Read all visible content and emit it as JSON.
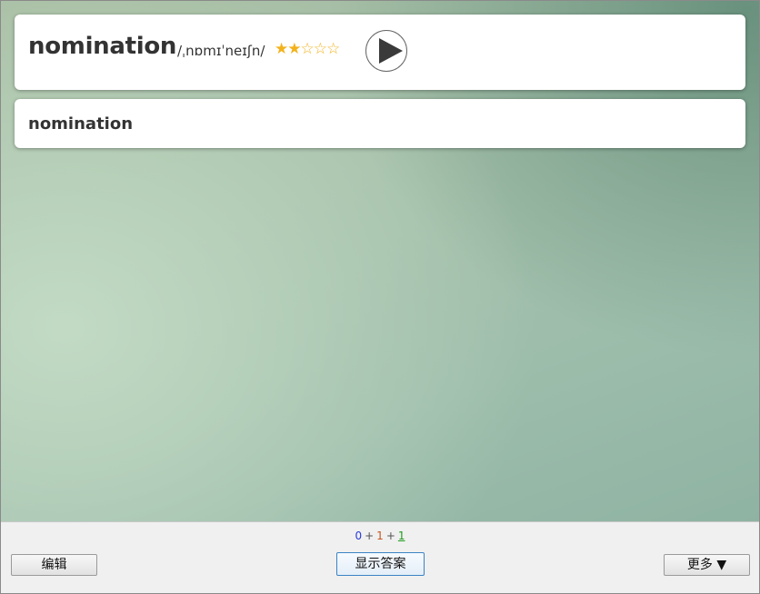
{
  "front": {
    "word": "nomination",
    "phonetic": "/ˌnɒmɪˈneɪʃn/",
    "stars": "★★☆☆☆",
    "rating": 2,
    "rating_max": 5
  },
  "back": {
    "word": "nomination"
  },
  "counts": {
    "new": "0",
    "learning": "1",
    "review": "1",
    "separator": "+"
  },
  "buttons": {
    "edit": "编辑",
    "show_answer": "显示答案",
    "more": "更多 ▼"
  },
  "icons": {
    "play": "play-icon"
  },
  "colors": {
    "star": "#f3b21c",
    "new_count": "#2a3bd6",
    "learning_count": "#c4581f",
    "review_count": "#1e9a1e",
    "show_answer_border": "#3b83c4"
  }
}
